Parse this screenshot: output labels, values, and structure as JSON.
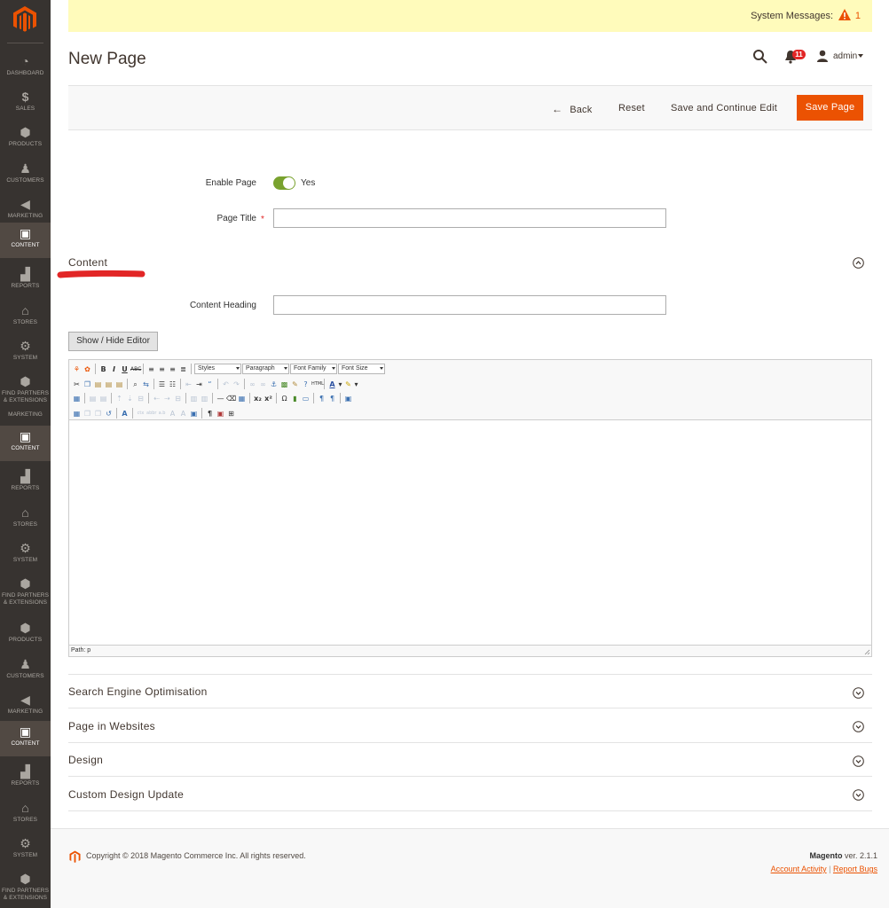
{
  "system_messages": {
    "label": "System Messages:",
    "count": "1"
  },
  "header": {
    "title": "New Page",
    "notifications_count": "11",
    "user": "admin"
  },
  "actions": {
    "back": "Back",
    "reset": "Reset",
    "save_continue": "Save and Continue Edit",
    "save": "Save Page"
  },
  "form": {
    "enable_label": "Enable Page",
    "enable_value": "Yes",
    "title_label": "Page Title",
    "title_value": "",
    "content_section": "Content",
    "content_heading_label": "Content Heading",
    "content_heading_value": "",
    "show_hide_editor": "Show / Hide Editor"
  },
  "editor": {
    "styles": "Styles",
    "paragraph": "Paragraph",
    "font_family": "Font Family",
    "font_size": "Font Size",
    "path": "Path: p"
  },
  "sections": [
    "Search Engine Optimisation",
    "Page in Websites",
    "Design",
    "Custom Design Update"
  ],
  "sidebar": {
    "items": [
      {
        "label": "Dashboard",
        "icon": "dashboard-icon"
      },
      {
        "label": "Sales",
        "icon": "dollar-icon"
      },
      {
        "label": "Products",
        "icon": "cube-icon"
      },
      {
        "label": "Customers",
        "icon": "person-icon"
      },
      {
        "label": "Marketing",
        "icon": "megaphone-icon"
      },
      {
        "label": "Content",
        "icon": "layout-icon"
      },
      {
        "label": "Reports",
        "icon": "bar-chart-icon"
      },
      {
        "label": "Stores",
        "icon": "storefront-icon"
      },
      {
        "label": "System",
        "icon": "gear-icon"
      },
      {
        "label": "Find Partners & Extensions",
        "icon": "cube-icon"
      },
      {
        "label": "Marketing",
        "icon": "none"
      },
      {
        "label": "Content",
        "icon": "layout-icon"
      },
      {
        "label": "Reports",
        "icon": "bar-chart-icon"
      },
      {
        "label": "Stores",
        "icon": "storefront-icon"
      },
      {
        "label": "System",
        "icon": "gear-icon"
      },
      {
        "label": "Find Partners & Extensions",
        "icon": "cube-icon"
      },
      {
        "label": "Products",
        "icon": "cube-icon"
      },
      {
        "label": "Customers",
        "icon": "person-icon"
      },
      {
        "label": "Marketing",
        "icon": "megaphone-icon"
      },
      {
        "label": "Content",
        "icon": "layout-icon"
      },
      {
        "label": "Reports",
        "icon": "bar-chart-icon"
      },
      {
        "label": "Stores",
        "icon": "storefront-icon"
      },
      {
        "label": "System",
        "icon": "gear-icon"
      },
      {
        "label": "Find Partners & Extensions",
        "icon": "cube-icon"
      }
    ]
  },
  "footer": {
    "copyright": "Copyright © 2018 Magento Commerce Inc. All rights reserved.",
    "brand": "Magento",
    "version": "ver. 2.1.1",
    "account_activity": "Account Activity",
    "separator": "|",
    "report_bugs": "Report Bugs"
  },
  "colors": {
    "accent": "#eb5202",
    "sidebar": "#373330",
    "toggle_on": "#79a22e",
    "sysbar": "#fffbbb"
  }
}
